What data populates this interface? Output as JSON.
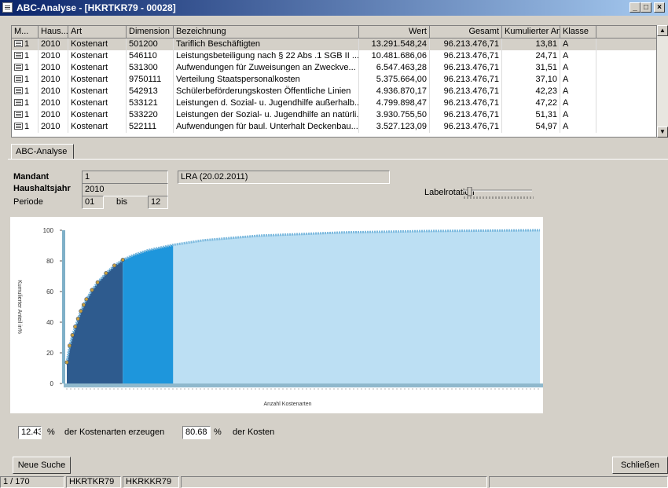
{
  "window": {
    "title": "ABC-Analyse - [HKRTKR79 - 00028]",
    "min": "_",
    "max": "□",
    "close": "×"
  },
  "grid": {
    "columns": [
      "M...",
      "Haus...",
      "Art",
      "Dimension",
      "Bezeichnung",
      "Wert",
      "Gesamt",
      "Kumulierter Anteil",
      "Klasse"
    ],
    "rows": [
      [
        "1",
        "2010",
        "Kostenart",
        "501200",
        "Tariflich Beschäftigten",
        "13.291.548,24",
        "96.213.476,71",
        "13,81",
        "A"
      ],
      [
        "1",
        "2010",
        "Kostenart",
        "546110",
        "Leistungsbeteiligung nach § 22 Abs .1 SGB II ...",
        "10.481.686,06",
        "96.213.476,71",
        "24,71",
        "A"
      ],
      [
        "1",
        "2010",
        "Kostenart",
        "531300",
        "Aufwendungen für Zuweisungen an Zweckve...",
        "6.547.463,28",
        "96.213.476,71",
        "31,51",
        "A"
      ],
      [
        "1",
        "2010",
        "Kostenart",
        "9750111",
        "Verteilung Staatspersonalkosten",
        "5.375.664,00",
        "96.213.476,71",
        "37,10",
        "A"
      ],
      [
        "1",
        "2010",
        "Kostenart",
        "542913",
        "Schülerbeförderungskosten Öffentliche Linien",
        "4.936.870,17",
        "96.213.476,71",
        "42,23",
        "A"
      ],
      [
        "1",
        "2010",
        "Kostenart",
        "533121",
        "Leistungen d. Sozial- u. Jugendhilfe außerhalb...",
        "4.799.898,47",
        "96.213.476,71",
        "47,22",
        "A"
      ],
      [
        "1",
        "2010",
        "Kostenart",
        "533220",
        "Leistungen der Sozial- u. Jugendhilfe an natürli...",
        "3.930.755,50",
        "96.213.476,71",
        "51,31",
        "A"
      ],
      [
        "1",
        "2010",
        "Kostenart",
        "522111",
        "Aufwendungen für baul. Unterhalt Deckenbau...",
        "3.527.123,09",
        "96.213.476,71",
        "54,97",
        "A"
      ]
    ]
  },
  "tab": {
    "label": "ABC-Analyse"
  },
  "form": {
    "mandant_label": "Mandant",
    "mandant_value": "1",
    "mandant_desc": "LRA    (20.02.2011)",
    "haushaltsjahr_label": "Haushaltsjahr",
    "haushaltsjahr_value": "2010",
    "periode_label": "Periode",
    "periode_from": "01",
    "bis_label": "bis",
    "periode_to": "12",
    "labelrotation_label": "Labelrotation"
  },
  "chart_data": {
    "type": "area",
    "ylabel": "Kumulierter Anteil in%",
    "xlabel": "Anzahl Kostenarten",
    "ylim": [
      0,
      100
    ],
    "yticks": [
      0,
      20,
      40,
      60,
      80,
      100
    ],
    "xlim": [
      1,
      170
    ],
    "class_boundaries": [
      21,
      39,
      170
    ],
    "class_colors": [
      "#2e5b8e",
      "#1e96dc",
      "#bcdff3"
    ],
    "x": [
      1,
      2,
      3,
      4,
      5,
      6,
      7,
      8,
      10,
      12,
      15,
      18,
      21,
      25,
      30,
      39,
      50,
      70,
      100,
      130,
      170
    ],
    "y": [
      13.81,
      24.71,
      31.51,
      37.1,
      42.23,
      47.22,
      51.31,
      54.97,
      61,
      66,
      72,
      77,
      80.68,
      84,
      87,
      90.5,
      93.5,
      96.5,
      98.6,
      99.5,
      100
    ],
    "grid": false,
    "legend": "none"
  },
  "summary": {
    "percent_kostenarten": "12.43",
    "percent_sign_1": "%",
    "text1": "der Kostenarten erzeugen",
    "percent_kosten": "80.68",
    "percent_sign_2": "%",
    "text2": "der Kosten"
  },
  "buttons": {
    "new_search": "Neue Suche",
    "close": "Schließen"
  },
  "status": {
    "record": "1 / 170",
    "p2": "HKRTKR79",
    "p3": "HKRKKR79"
  }
}
